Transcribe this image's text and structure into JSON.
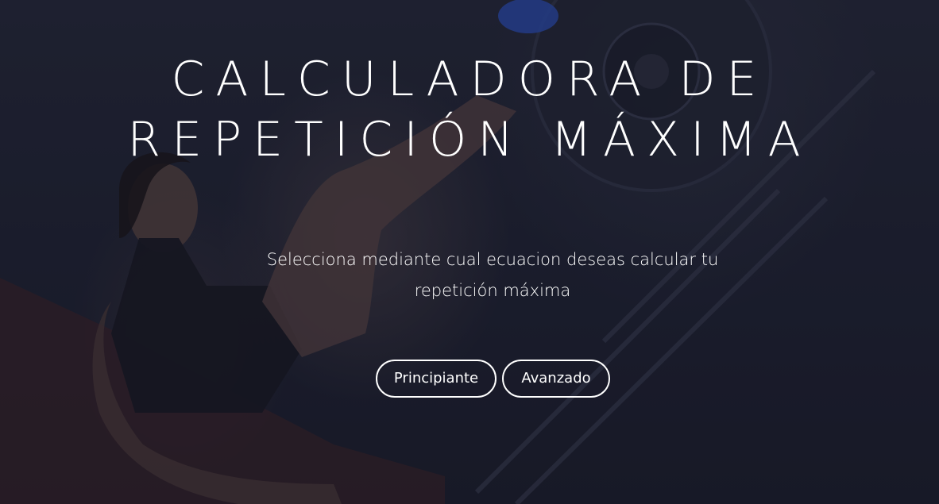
{
  "hero": {
    "title_line1": "CALCULADORA DE",
    "title_line2": "REPETICIÓN MÁXIMA",
    "subtitle": "Selecciona mediante cual ecuacion deseas calcular tu repetición máxima",
    "background_image": "woman-leg-press-gym-photo"
  },
  "buttons": {
    "beginner_label": "Principiante",
    "advanced_label": "Avanzado"
  },
  "colors": {
    "text": "#ffffff",
    "overlay": "#141626",
    "button_border": "#ffffff"
  }
}
